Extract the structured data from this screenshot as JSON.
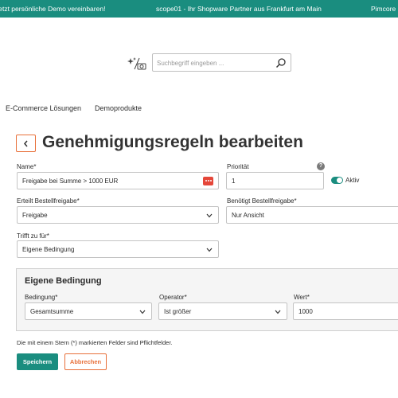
{
  "topbar": {
    "left_text": "Jetzt persönliche Demo vereinbaren!",
    "center_text": "scope01 - Ihr Shopware Partner aus Frankfurt am Main",
    "right_text": "Pimcore P"
  },
  "search": {
    "placeholder": "Suchbegriff eingeben ...",
    "value": ""
  },
  "nav": {
    "items": [
      "E-Commerce Lösungen",
      "Demoprodukte"
    ]
  },
  "page": {
    "title": "Genehmigungsregeln bearbeiten"
  },
  "form": {
    "name": {
      "label": "Name*",
      "value": "Freigabe bei Summe > 1000 EUR"
    },
    "priority": {
      "label": "Priorität",
      "value": "1"
    },
    "active": {
      "label": "Aktiv",
      "on": true
    },
    "issued_approval": {
      "label": "Erteilt Bestellfreigabe*",
      "value": "Freigabe"
    },
    "requires_approval": {
      "label": "Benötigt Bestellfreigabe*",
      "value": "Nur Ansicht"
    },
    "applies_to": {
      "label": "Trifft zu für*",
      "value": "Eigene Bedingung"
    }
  },
  "condition": {
    "title": "Eigene Bedingung",
    "condition_field": {
      "label": "Bedingung*",
      "value": "Gesamtsumme"
    },
    "operator_field": {
      "label": "Operator*",
      "value": "Ist größer"
    },
    "value_field": {
      "label": "Wert*",
      "value": "1000"
    }
  },
  "required_note": "Die mit einem Stern (*) markierten Felder sind Pflichtfelder.",
  "buttons": {
    "save": "Speichern",
    "cancel": "Abbrechen"
  },
  "colors": {
    "primary": "#1a8d7f",
    "accent": "#e8703a",
    "danger": "#e5473a"
  },
  "icons": {
    "search_suggest": "sparkle-camera-icon",
    "search": "magnifier-icon",
    "back": "chevron-left-icon",
    "help": "question-circle-icon",
    "password_manager": "dots-icon",
    "dropdown": "chevron-down-icon"
  }
}
